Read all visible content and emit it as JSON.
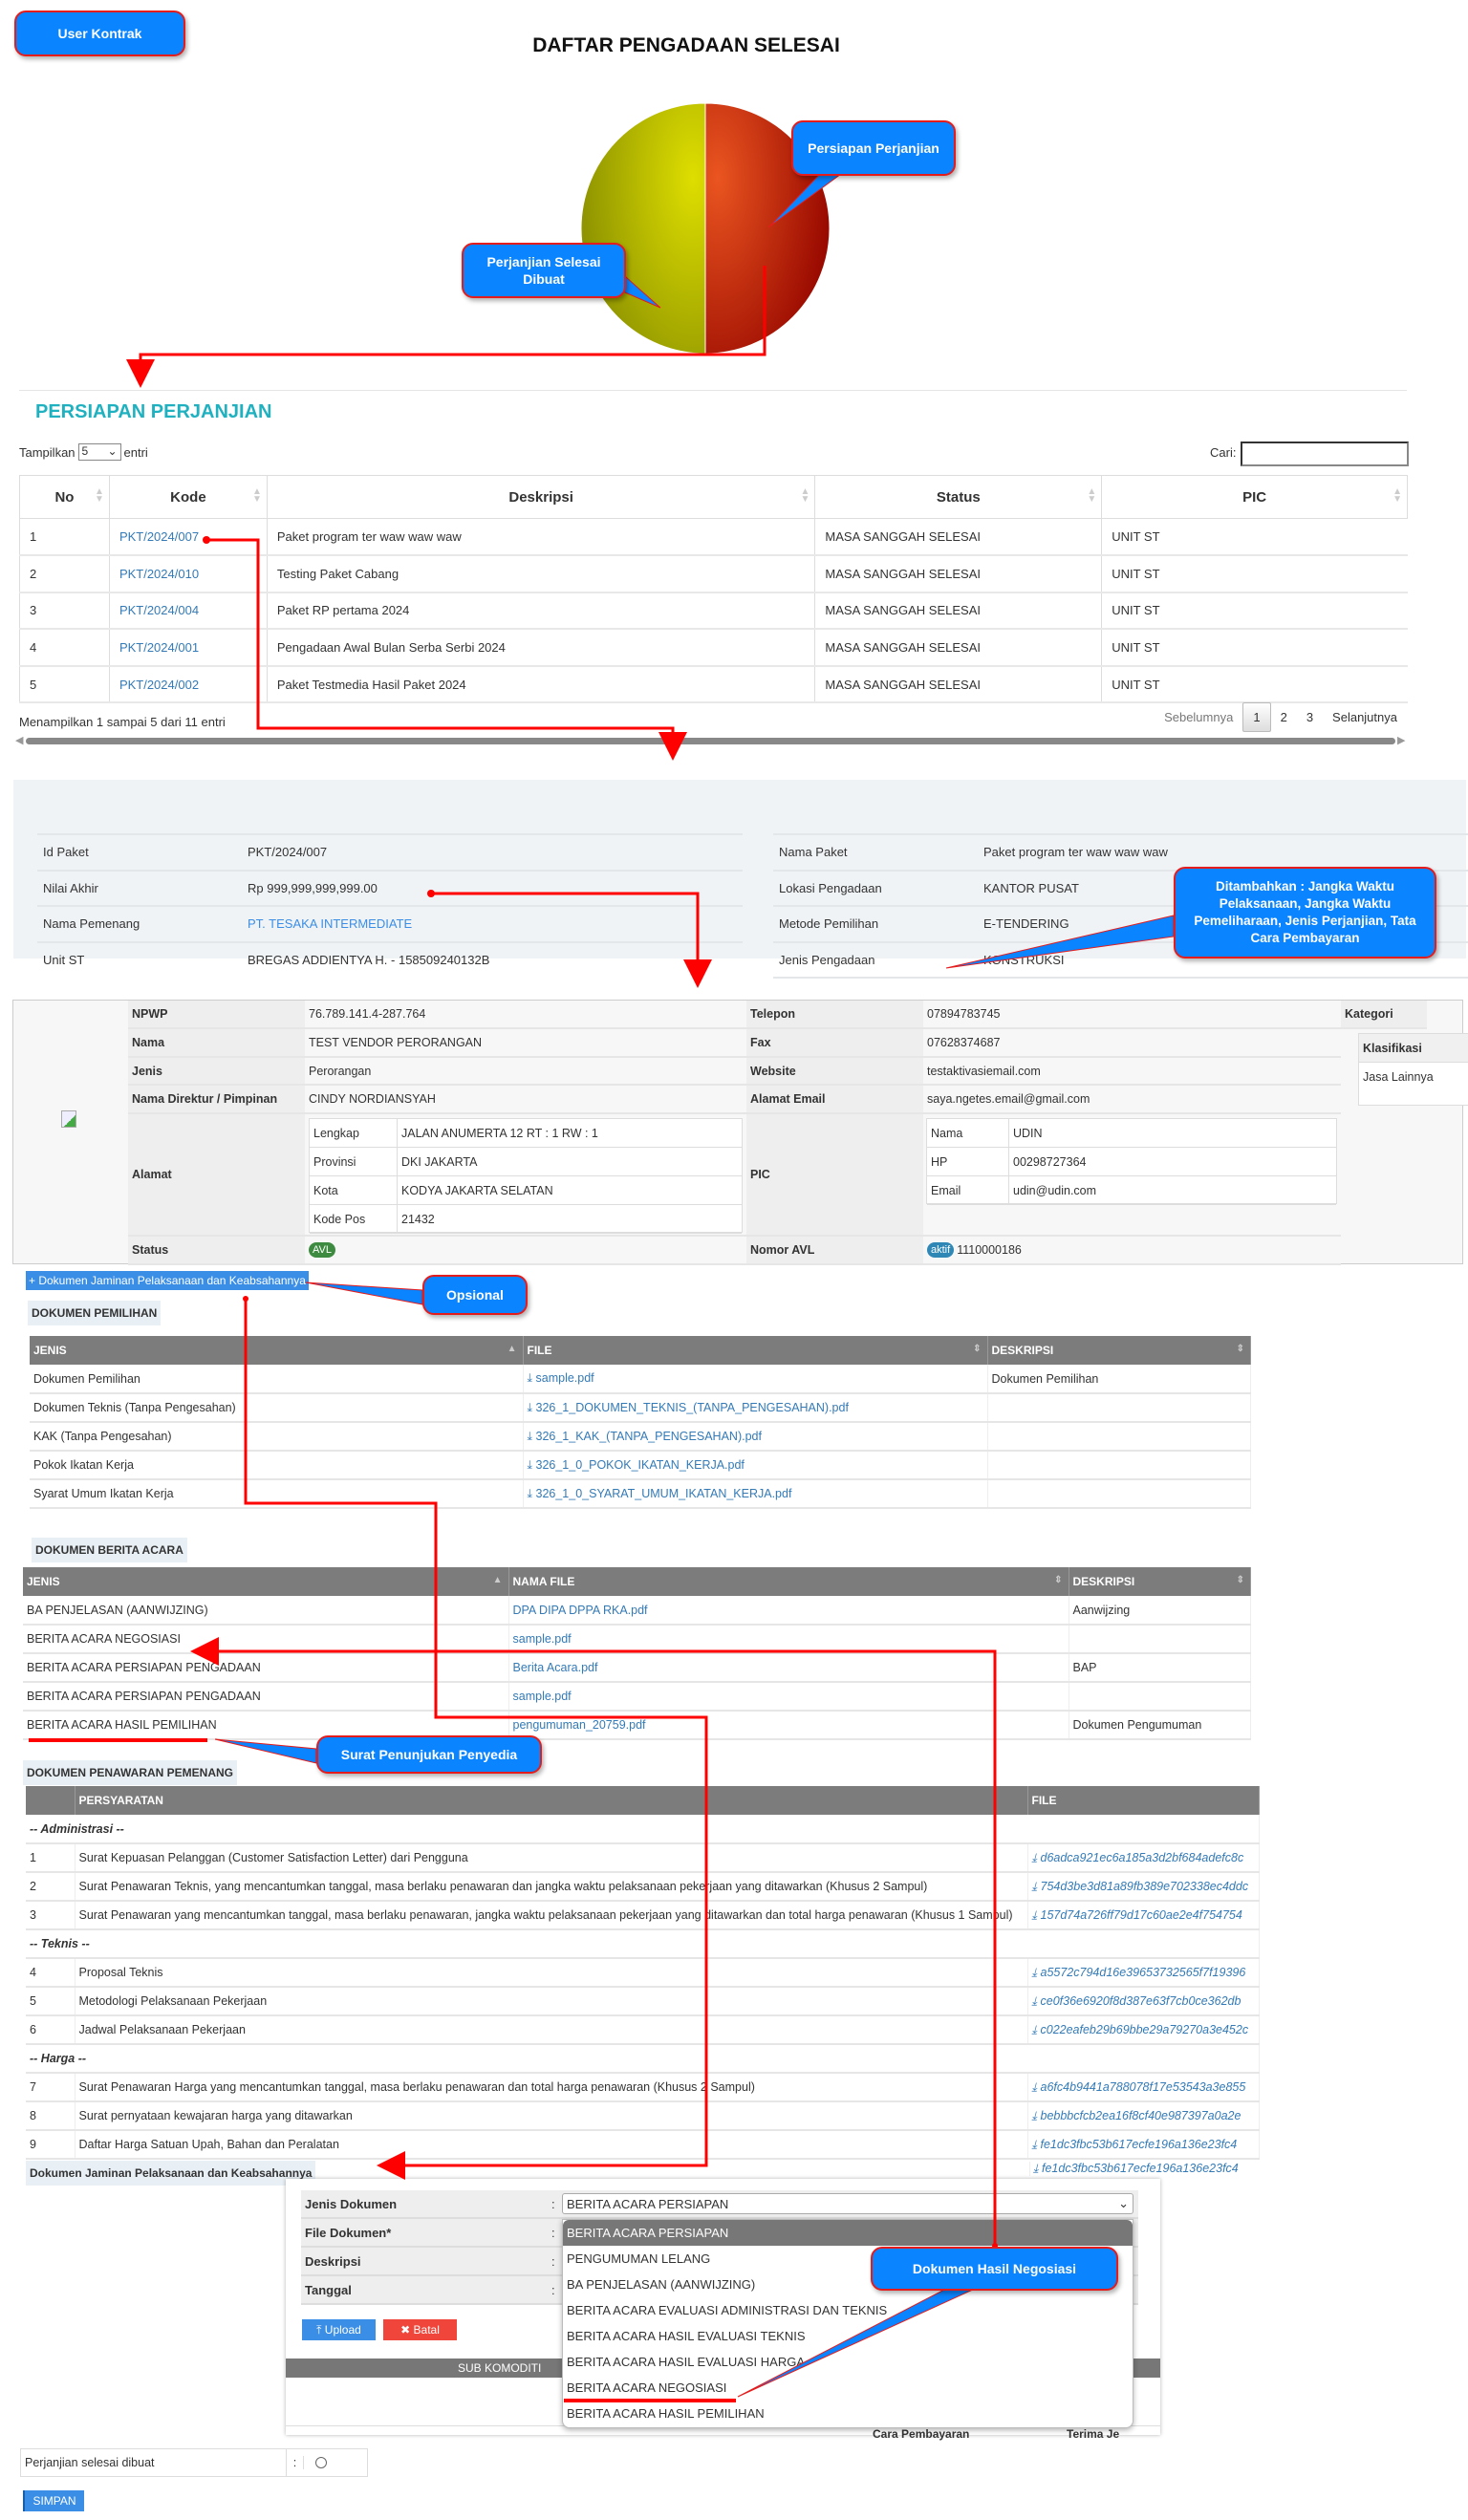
{
  "callouts": {
    "user_kontrak": "User Kontrak",
    "persiapan": "Persiapan Perjanjian",
    "selesai": "Perjanjian Selesai Dibuat",
    "ditambahkan": "Ditambahkan : Jangka Waktu Pelaksanaan, Jangka Waktu Pemeliharaan, Jenis Perjanjian, Tata Cara Pembayaran",
    "opsional": "Opsional",
    "surat_penunjukan": "Surat Penunjukan Penyedia",
    "hasil_negosiasi": "Dokumen Hasil Negosiasi"
  },
  "page_title": "DAFTAR PENGADAAN SELESAI",
  "chart_data": {
    "type": "pie",
    "slices": [
      {
        "label": "Perjanjian Selesai Dibuat",
        "share": 0.5,
        "color": "#c8c800"
      },
      {
        "label": "Persiapan Perjanjian",
        "share": 0.5,
        "color": "#c8300a"
      }
    ]
  },
  "section_title": "PERSIAPAN PERJANJIAN",
  "datatable": {
    "show_label": "Tampilkan",
    "show_value": "5",
    "entries_label": "entri",
    "search_label": "Cari:",
    "search_value": "",
    "headers": [
      "No",
      "Kode",
      "Deskripsi",
      "Status",
      "PIC"
    ],
    "rows": [
      [
        "1",
        "PKT/2024/007",
        "Paket program ter waw waw waw",
        "MASA SANGGAH SELESAI",
        "UNIT ST"
      ],
      [
        "2",
        "PKT/2024/010",
        "Testing Paket Cabang",
        "MASA SANGGAH SELESAI",
        "UNIT ST"
      ],
      [
        "3",
        "PKT/2024/004",
        "Paket RP pertama 2024",
        "MASA SANGGAH SELESAI",
        "UNIT ST"
      ],
      [
        "4",
        "PKT/2024/001",
        "Pengadaan Awal Bulan Serba Serbi 2024",
        "MASA SANGGAH SELESAI",
        "UNIT ST"
      ],
      [
        "5",
        "PKT/2024/002",
        "Paket Testmedia Hasil Paket 2024",
        "MASA SANGGAH SELESAI",
        "UNIT ST"
      ]
    ],
    "info": "Menampilkan 1 sampai 5 dari 11 entri",
    "prev": "Sebelumnya",
    "pages": [
      "1",
      "2",
      "3"
    ],
    "next": "Selanjutnya"
  },
  "paket_info": {
    "left": [
      {
        "label": "Id Paket",
        "value": "PKT/2024/007"
      },
      {
        "label": "Nilai Akhir",
        "value": "Rp 999,999,999,999.00"
      },
      {
        "label": "Nama Pemenang",
        "value": "PT. TESAKA INTERMEDIATE"
      },
      {
        "label": "Unit ST",
        "value": "BREGAS ADDIENTYA H. - 158509240132B"
      }
    ],
    "right": [
      {
        "label": "Nama Paket",
        "value": "Paket program ter waw waw waw"
      },
      {
        "label": "Lokasi Pengadaan",
        "value": "KANTOR PUSAT"
      },
      {
        "label": "Metode Pemilihan",
        "value": "E-TENDERING"
      },
      {
        "label": "Jenis Pengadaan",
        "value": "KONSTRUKSI"
      }
    ]
  },
  "vendor": {
    "npwp_l": "NPWP",
    "npwp": "76.789.141.4-287.764",
    "telepon_l": "Telepon",
    "telepon": "07894783745",
    "nama_l": "Nama",
    "nama": "TEST VENDOR PERORANGAN",
    "fax_l": "Fax",
    "fax": "07628374687",
    "jenis_l": "Jenis",
    "jenis": "Perorangan",
    "website_l": "Website",
    "website": "testaktivasiemail.com",
    "direktur_l": "Nama Direktur / Pimpinan",
    "direktur": "CINDY NORDIANSYAH",
    "email_l": "Alamat Email",
    "email": "saya.ngetes.email@gmail.com",
    "alamat_l": "Alamat",
    "alamat": [
      {
        "k": "Lengkap",
        "v": "JALAN ANUMERTA 12 RT : 1 RW : 1"
      },
      {
        "k": "Provinsi",
        "v": "DKI JAKARTA"
      },
      {
        "k": "Kota",
        "v": "KODYA JAKARTA SELATAN"
      },
      {
        "k": "Kode Pos",
        "v": "21432"
      }
    ],
    "pic_l": "PIC",
    "pic": [
      {
        "k": "Nama",
        "v": "UDIN"
      },
      {
        "k": "HP",
        "v": "00298727364"
      },
      {
        "k": "Email",
        "v": "udin@udin.com"
      }
    ],
    "status_l": "Status",
    "status": "AVL",
    "avl_l": "Nomor AVL",
    "avl_badge": "aktif",
    "avl": "1110000186",
    "kategori_l": "Kategori",
    "klasifikasi_l": "Klasifikasi",
    "klasifikasi": "Jasa Lainnya"
  },
  "add_jaminan_button": "Dokumen Jaminan Pelaksanaan dan Keabsahannya",
  "dok_pemilihan": {
    "title": "DOKUMEN PEMILIHAN",
    "headers": [
      "JENIS",
      "FILE",
      "DESKRIPSI"
    ],
    "rows": [
      [
        "Dokumen Pemilihan",
        "sample.pdf",
        "Dokumen Pemilihan"
      ],
      [
        "Dokumen Teknis (Tanpa Pengesahan)",
        "326_1_DOKUMEN_TEKNIS_(TANPA_PENGESAHAN).pdf",
        ""
      ],
      [
        "KAK (Tanpa Pengesahan)",
        "326_1_KAK_(TANPA_PENGESAHAN).pdf",
        ""
      ],
      [
        "Pokok Ikatan Kerja",
        "326_1_0_POKOK_IKATAN_KERJA.pdf",
        ""
      ],
      [
        "Syarat Umum Ikatan Kerja",
        "326_1_0_SYARAT_UMUM_IKATAN_KERJA.pdf",
        ""
      ]
    ]
  },
  "dok_ba": {
    "title": "DOKUMEN BERITA ACARA",
    "headers": [
      "JENIS",
      "NAMA FILE",
      "DESKRIPSI"
    ],
    "rows": [
      [
        "BA PENJELASAN (AANWIJZING)",
        "DPA DIPA DPPA RKA.pdf",
        "Aanwijzing"
      ],
      [
        "BERITA ACARA NEGOSIASI",
        "sample.pdf",
        ""
      ],
      [
        "BERITA ACARA PERSIAPAN PENGADAAN",
        "Berita Acara.pdf",
        "BAP"
      ],
      [
        "BERITA ACARA PERSIAPAN PENGADAAN",
        "sample.pdf",
        ""
      ],
      [
        "BERITA ACARA HASIL PEMILIHAN",
        "pengumuman_20759.pdf",
        "Dokumen Pengumuman"
      ]
    ]
  },
  "dok_penawaran": {
    "title": "DOKUMEN PENAWARAN PEMENANG",
    "headers": [
      "",
      "PERSYARATAN",
      "FILE"
    ],
    "rows": [
      {
        "group": "-- Administrasi --"
      },
      {
        "no": "1",
        "text": "Surat Kepuasan Pelanggan (Customer Satisfaction Letter) dari Pengguna",
        "file": "d6adca921ec6a185a3d2bf684adefc8c"
      },
      {
        "no": "2",
        "text": "Surat Penawaran Teknis, yang mencantumkan tanggal, masa berlaku penawaran dan jangka waktu pelaksanaan pekerjaan yang ditawarkan (Khusus 2 Sampul)",
        "file": "754d3be3d81a89fb389e702338ec4ddc"
      },
      {
        "no": "3",
        "text": "Surat Penawaran yang mencantumkan tanggal, masa berlaku penawaran, jangka waktu pelaksanaan pekerjaan yang ditawarkan dan total harga penawaran (Khusus 1 Sampul)",
        "file": "157d74a726ff79d17c60ae2e4f754754"
      },
      {
        "group": "-- Teknis --"
      },
      {
        "no": "4",
        "text": "Proposal Teknis",
        "file": "a5572c794d16e39653732565f7f19396"
      },
      {
        "no": "5",
        "text": "Metodologi Pelaksanaan Pekerjaan",
        "file": "ce0f36e6920f8d387e63f7cb0ce362db"
      },
      {
        "no": "6",
        "text": "Jadwal Pelaksanaan Pekerjaan",
        "file": "c022eafeb29b69bbe29a79270a3e452c"
      },
      {
        "group": "-- Harga --"
      },
      {
        "no": "7",
        "text": "Surat Penawaran Harga yang mencantumkan tanggal, masa berlaku penawaran dan total harga penawaran (Khusus 2 Sampul)",
        "file": "a6fc4b9441a788078f17e53543a3e855"
      },
      {
        "no": "8",
        "text": "Surat pernyataan kewajaran harga yang ditawarkan",
        "file": "bebbbcfcb2ea16f8cf40e987397a0a2e"
      },
      {
        "no": "9",
        "text": "Daftar Harga Satuan Upah, Bahan dan Peralatan",
        "file": "fe1dc3fbc53b617ecfe196a136e23fc4"
      }
    ],
    "extra_file": "fe1dc3fbc53b617ecfe196a136e23fc4"
  },
  "jaminan": {
    "title": "Dokumen Jaminan Pelaksanaan dan Keabsahannya",
    "labels": [
      "Jenis Dokumen",
      "File Dokumen*",
      "Deskripsi",
      "Tanggal"
    ],
    "colon": ":",
    "jenis_value": "BERITA ACARA PERSIAPAN",
    "options": [
      "BERITA ACARA PERSIAPAN",
      "PENGUMUMAN LELANG",
      "BA PENJELASAN (AANWIJZING)",
      "BERITA ACARA EVALUASI ADMINISTRASI DAN TEKNIS",
      "BERITA ACARA HASIL EVALUASI TEKNIS",
      "BERITA ACARA HASIL EVALUASI HARGA",
      "BERITA ACARA NEGOSIASI",
      "BERITA ACARA HASIL PEMILIHAN"
    ],
    "upload": "Upload",
    "batal": "Batal",
    "sub_komoditi": "SUB KOMODITI",
    "cara_pembayaran": "Cara Pembayaran",
    "terima": "Terima Je"
  },
  "perjanjian_label": "Perjanjian selesai dibuat",
  "simpan": "SIMPAN"
}
